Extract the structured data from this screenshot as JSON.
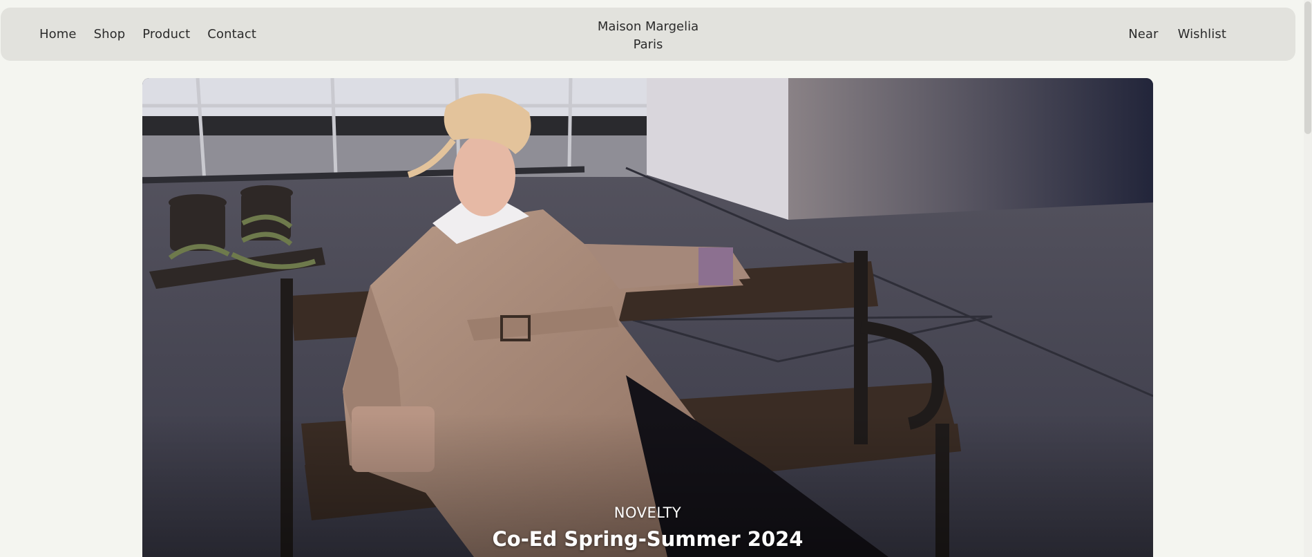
{
  "nav": {
    "left_links": [
      "Home",
      "Shop",
      "Product",
      "Contact"
    ],
    "brand_line1": "Maison Margelia",
    "brand_line2": "Paris",
    "right_links": [
      "Near",
      "Wishlist"
    ]
  },
  "hero": {
    "eyebrow": "NOVELTY",
    "title": "Co-Ed Spring-Summer 2024",
    "image_subject": "model-in-trench-coat-on-bench"
  },
  "colors": {
    "page_background": "#f4f5f0",
    "nav_background": "#e2e2dd",
    "text": "#2b2b2b",
    "hero_text": "#ffffff"
  }
}
